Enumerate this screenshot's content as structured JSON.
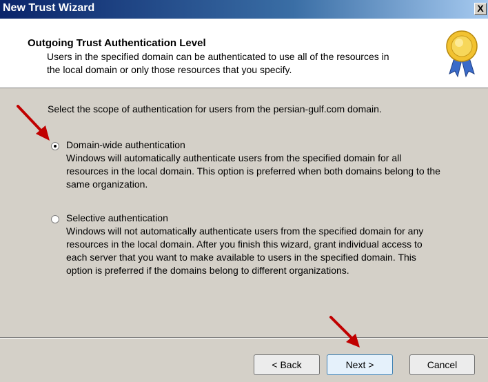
{
  "window": {
    "title": "New Trust Wizard",
    "close_label": "X"
  },
  "header": {
    "title": "Outgoing Trust Authentication Level",
    "subtitle_line1": "Users in the specified domain can be authenticated to use all of the resources in",
    "subtitle_line2": "the local domain or only those resources that you specify."
  },
  "content": {
    "prompt": "Select the scope of authentication for users from the persian-gulf.com domain.",
    "options": [
      {
        "label": "Domain-wide authentication",
        "selected": true,
        "desc_lines": [
          "Windows will automatically authenticate users from the specified domain for all",
          "resources in the local domain. This option is preferred when both domains belong to the",
          "same organization."
        ]
      },
      {
        "label": "Selective authentication",
        "selected": false,
        "desc_lines": [
          "Windows will not automatically authenticate users from the specified domain for any",
          "resources in the local domain. After you finish this wizard, grant individual access to",
          "each server that you want to make available to users in the specified domain. This",
          "option is preferred if the domains belong to different organizations."
        ]
      }
    ]
  },
  "footer": {
    "back_label": "< Back",
    "next_label": "Next >",
    "cancel_label": "Cancel"
  },
  "colors": {
    "title_bar": "#0a246a",
    "dialog_face": "#d4d0c8",
    "annotation_arrow": "#c00000"
  },
  "icons": {
    "header_icon": "medal-icon",
    "annotation": "red-arrow-icon"
  }
}
